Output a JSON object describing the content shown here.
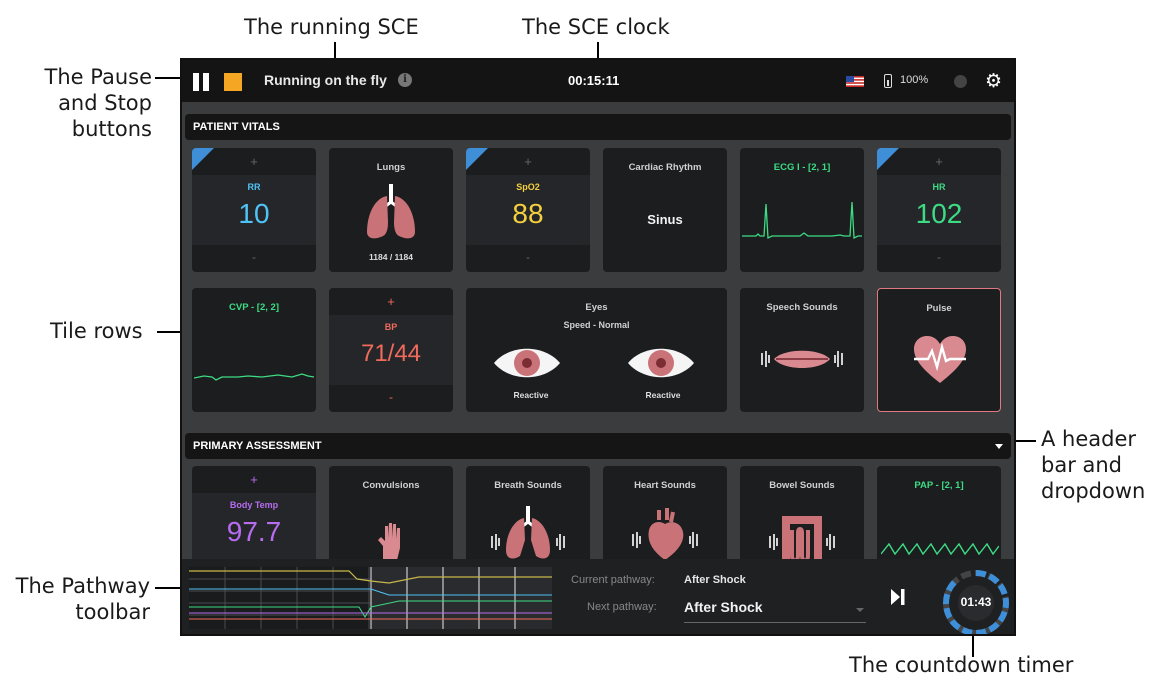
{
  "annotations": {
    "running_sce": "The running SCE",
    "sce_clock": "The SCE clock",
    "pause_stop": [
      "The Pause",
      "and Stop",
      "buttons"
    ],
    "tile_rows": "Tile rows",
    "header_dropdown": [
      "A header",
      "bar and",
      "dropdown"
    ],
    "pathway_toolbar": [
      "The Pathway",
      "toolbar"
    ],
    "countdown_timer": "The countdown timer"
  },
  "topbar": {
    "sce_name": "Running on the fly",
    "info": "i",
    "clock": "00:15:11",
    "battery": "100%",
    "settings": "⚙"
  },
  "sections": {
    "patient_vitals": "PATIENT VITALS",
    "primary_assessment": "PRIMARY ASSESSMENT"
  },
  "vitals_row1": {
    "rr": {
      "label": "RR",
      "value": "10",
      "plus": "+",
      "minus": "-"
    },
    "lungs": {
      "title": "Lungs",
      "caption": "1184 / 1184"
    },
    "spo2": {
      "label": "SpO2",
      "value": "88",
      "plus": "+",
      "minus": "-"
    },
    "cardiac": {
      "title": "Cardiac Rhythm",
      "value": "Sinus"
    },
    "ecg": {
      "title": "ECG I - [2, 1]"
    },
    "hr": {
      "label": "HR",
      "value": "102",
      "plus": "+",
      "minus": "-"
    }
  },
  "vitals_row2": {
    "cvp": {
      "title": "CVP - [2, 2]"
    },
    "bp": {
      "label": "BP",
      "value": "71/44",
      "plus": "+",
      "minus": "-"
    },
    "eyes": {
      "title": "Eyes",
      "subtitle": "Speed - Normal",
      "left": "Reactive",
      "right": "Reactive"
    },
    "speech": {
      "title": "Speech Sounds"
    },
    "pulse": {
      "title": "Pulse"
    }
  },
  "assessment_row": {
    "body_temp": {
      "label": "Body Temp",
      "value": "97.7",
      "plus": "+"
    },
    "convulsions": {
      "title": "Convulsions"
    },
    "breath": {
      "title": "Breath Sounds"
    },
    "heart": {
      "title": "Heart Sounds"
    },
    "bowel": {
      "title": "Bowel Sounds"
    },
    "pap": {
      "title": "PAP - [2, 1]"
    }
  },
  "pathway": {
    "current_label": "Current pathway:",
    "current_value": "After Shock",
    "next_label": "Next pathway:",
    "next_value": "After Shock"
  },
  "timer": {
    "value": "01:43",
    "progress": 0.88
  },
  "colors": {
    "rr": "#4fc3f7",
    "spo2": "#f4d03f",
    "hr": "#3ddc84",
    "ecg": "#3ddc84",
    "cvp": "#3ddc84",
    "bp": "#f06b5b",
    "body_temp": "#b86cf0",
    "pap": "#3ddc84",
    "timer": "#3e8ed8",
    "stop": "#f5a623"
  }
}
